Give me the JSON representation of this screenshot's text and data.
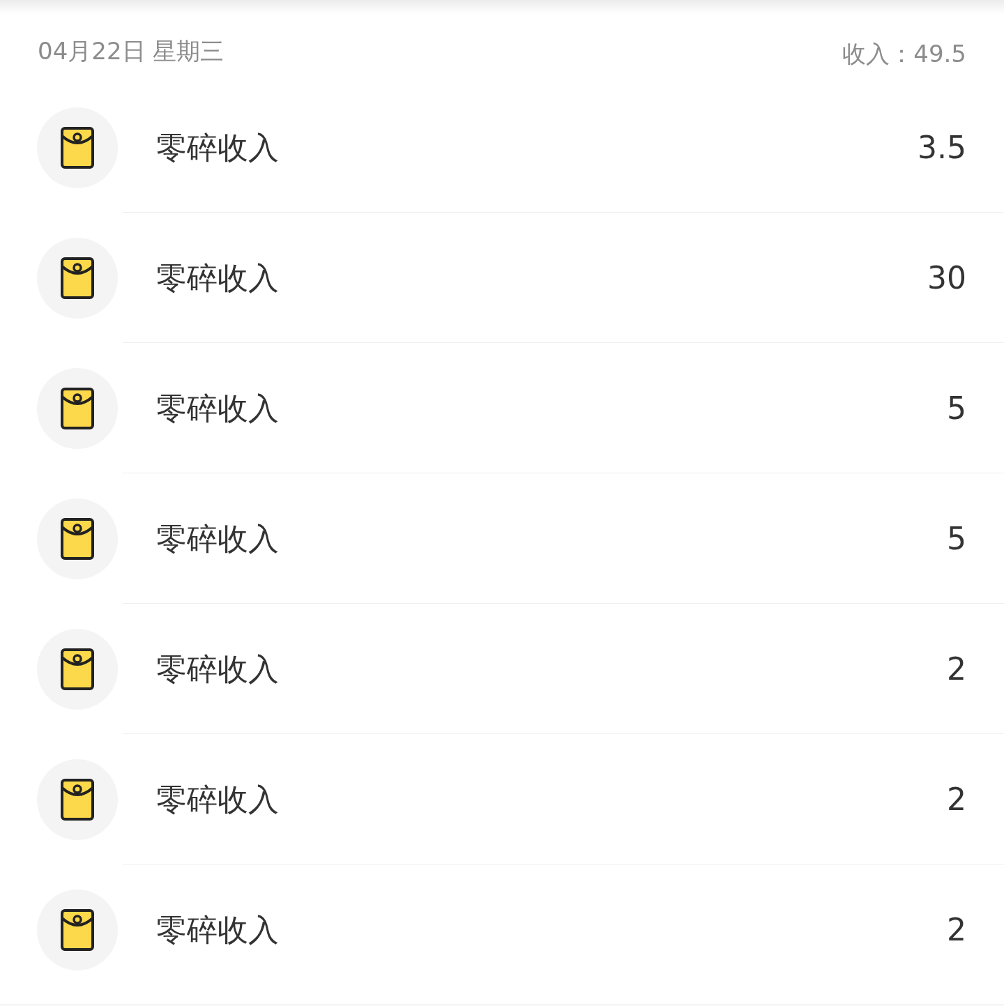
{
  "header": {
    "date": "04月22日 星期三",
    "income_label": "收入：",
    "income_total": "49.5"
  },
  "entries": [
    {
      "title": "零碎收入",
      "amount": "3.5"
    },
    {
      "title": "零碎收入",
      "amount": "30"
    },
    {
      "title": "零碎收入",
      "amount": "5"
    },
    {
      "title": "零碎收入",
      "amount": "5"
    },
    {
      "title": "零碎收入",
      "amount": "2"
    },
    {
      "title": "零碎收入",
      "amount": "2"
    },
    {
      "title": "零碎收入",
      "amount": "2"
    }
  ]
}
